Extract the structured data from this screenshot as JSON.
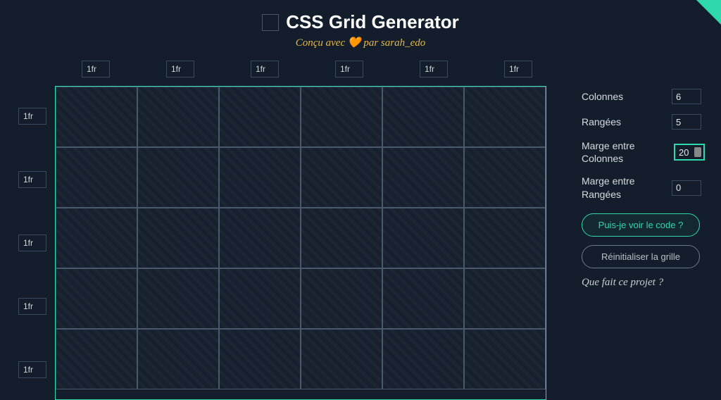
{
  "header": {
    "title": "CSS Grid Generator",
    "subtitle_prefix": "Conçu avec",
    "subtitle_heart": "🧡",
    "subtitle_by": "par",
    "subtitle_author": "sarah_edo"
  },
  "grid": {
    "columns": [
      "1fr",
      "1fr",
      "1fr",
      "1fr",
      "1fr",
      "1fr"
    ],
    "rows": [
      "1fr",
      "1fr",
      "1fr",
      "1fr",
      "1fr"
    ]
  },
  "sidebar": {
    "columns_label": "Colonnes",
    "columns_value": "6",
    "rows_label": "Rangées",
    "rows_value": "5",
    "column_gap_label": "Marge entre Colonnes",
    "column_gap_value": "20",
    "row_gap_label": "Marge entre Rangées",
    "row_gap_value": "0",
    "show_code_btn": "Puis-je voir le code ?",
    "reset_btn": "Réinitialiser la grille",
    "about_link": "Que fait ce projet ?"
  }
}
